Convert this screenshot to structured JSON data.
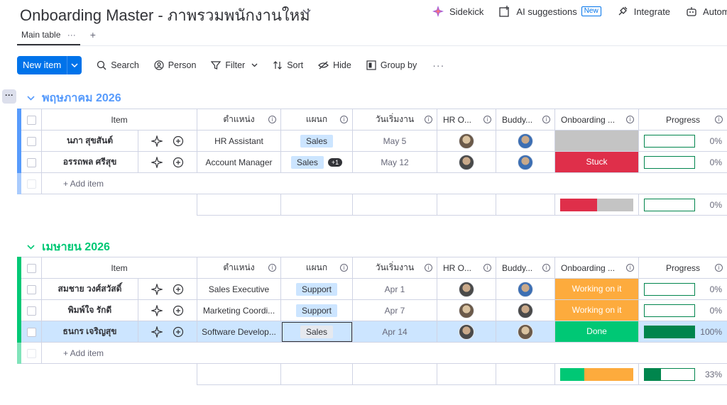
{
  "header": {
    "title": "Onboarding Master - ภาพรวมพนักงานใหม่",
    "sidekick": "Sidekick",
    "ai_suggestions": "AI suggestions",
    "new_badge": "New",
    "integrate": "Integrate",
    "automate": "Automat"
  },
  "tabs": {
    "main": "Main table",
    "dots": "···",
    "plus": "+"
  },
  "toolbar": {
    "new_item": "New item",
    "search": "Search",
    "person": "Person",
    "filter": "Filter",
    "sort": "Sort",
    "hide": "Hide",
    "group_by": "Group by",
    "more": "···"
  },
  "columns": {
    "item": "Item",
    "position": "ตำแหน่ง",
    "department": "แผนก",
    "start_date": "วันเริ่มงาน",
    "hr_owner": "HR O...",
    "buddy": "Buddy...",
    "onboarding": "Onboarding ...",
    "progress": "Progress"
  },
  "groups": [
    {
      "title": "พฤษภาคม 2026",
      "color": "#579bfc",
      "add_item": "+ Add item",
      "rows": [
        {
          "name": "นภา สุขสันต์",
          "position": "HR Assistant",
          "department": "Sales",
          "extra": "",
          "start": "May 5",
          "status": "",
          "status_color": "#c4c4c4",
          "progress": 0,
          "progress_label": "0%"
        },
        {
          "name": "อรรถพล ศรีสุข",
          "position": "Account Manager",
          "department": "Sales",
          "extra": "+1",
          "start": "May 12",
          "status": "Stuck",
          "status_color": "#df2f4a",
          "progress": 0,
          "progress_label": "0%"
        }
      ],
      "summary": {
        "segments": [
          {
            "color": "#df2f4a",
            "fraction": 0.5
          },
          {
            "color": "#c4c4c4",
            "fraction": 0.5
          }
        ],
        "progress": 0,
        "progress_label": "0%"
      }
    },
    {
      "title": "เมษายน 2026",
      "color": "#00c875",
      "add_item": "+ Add item",
      "rows": [
        {
          "name": "สมชาย วงศ์สวัสดิ์",
          "position": "Sales Executive",
          "department": "Support",
          "extra": "",
          "start": "Apr 1",
          "status": "Working on it",
          "status_color": "#fdab3d",
          "progress": 0,
          "progress_label": "0%"
        },
        {
          "name": "พิมพ์ใจ รักดี",
          "position": "Marketing Coordi...",
          "department": "Support",
          "extra": "",
          "start": "Apr 7",
          "status": "Working on it",
          "status_color": "#fdab3d",
          "progress": 0,
          "progress_label": "0%"
        },
        {
          "name": "ธนกร เจริญสุข",
          "position": "Software Develop...",
          "department": "Sales",
          "extra": "",
          "start": "Apr 14",
          "status": "Done",
          "status_color": "#00c875",
          "progress": 1,
          "progress_label": "100%"
        }
      ],
      "summary": {
        "segments": [
          {
            "color": "#00c875",
            "fraction": 0.33
          },
          {
            "color": "#fdab3d",
            "fraction": 0.67
          }
        ],
        "progress": 0.33,
        "progress_label": "33%"
      }
    }
  ],
  "colors": {
    "primary": "#0073ea",
    "done": "#00c875",
    "working": "#fdab3d",
    "stuck": "#df2f4a",
    "progress": "#00854d"
  }
}
